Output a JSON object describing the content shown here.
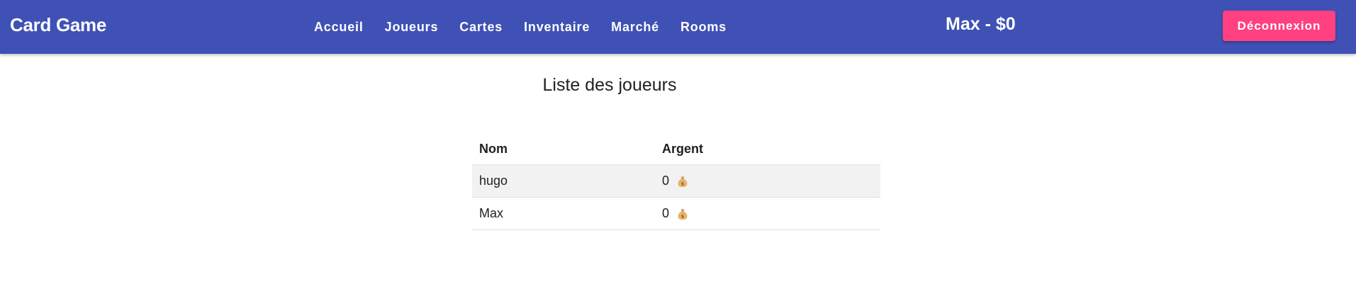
{
  "navbar": {
    "brand": "Card Game",
    "links": [
      "Accueil",
      "Joueurs",
      "Cartes",
      "Inventaire",
      "Marché",
      "Rooms"
    ],
    "user_info": "Max - $0",
    "logout_label": "Déconnexion",
    "colors": {
      "bar": "#3f51b5",
      "logout": "#ff4081"
    }
  },
  "main": {
    "title": "Liste des joueurs",
    "table": {
      "headers": [
        "Nom",
        "Argent"
      ],
      "rows": [
        {
          "name": "hugo",
          "money": "0",
          "icon": "money-bag-icon"
        },
        {
          "name": "Max",
          "money": "0",
          "icon": "money-bag-icon"
        }
      ]
    }
  }
}
